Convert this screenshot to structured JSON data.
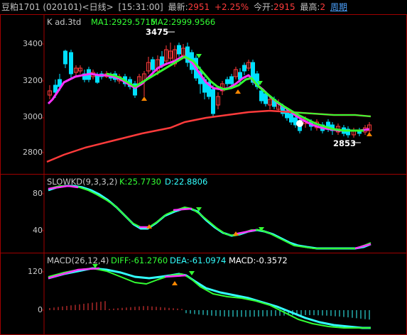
{
  "topbar": {
    "title": "豆粕1701 (020101)<日线>",
    "time": "[15:31:00]",
    "latest_label": "最新:",
    "latest_value": "2951",
    "change": "+2.25%",
    "open_label": "今开:",
    "open_value": "2915",
    "high_label": "最高:",
    "high_value": "2",
    "period_link": "周期"
  },
  "kpanel": {
    "title": "K  ad.3td",
    "ma1": "MA1:2929.5715",
    "ma2": "MA2:2999.9566",
    "high_annotation": "3475",
    "low_annotation": "2853",
    "yticks": [
      "3400",
      "3200",
      "3000",
      "2800"
    ]
  },
  "kdpanel": {
    "title": "SLOWKD(9,3,3,2)",
    "k": "K:25.7730",
    "d": "D:22.8806",
    "yticks": [
      "80",
      "40"
    ]
  },
  "macdpanel": {
    "title": "MACD(26,12,4)",
    "diff": "DIFF:-61.2760",
    "dea": "DEA:-61.0974",
    "macd": "MACD:-0.3572",
    "yticks": [
      "120",
      "0"
    ]
  },
  "colors": {
    "background": "#000000",
    "frame": "#a00000",
    "up": "#ff3b3b",
    "down": "#00e0ff",
    "ma_green": "#33ff33",
    "kd_cyan": "#33ffff",
    "magenta": "#ff33ff"
  }
}
